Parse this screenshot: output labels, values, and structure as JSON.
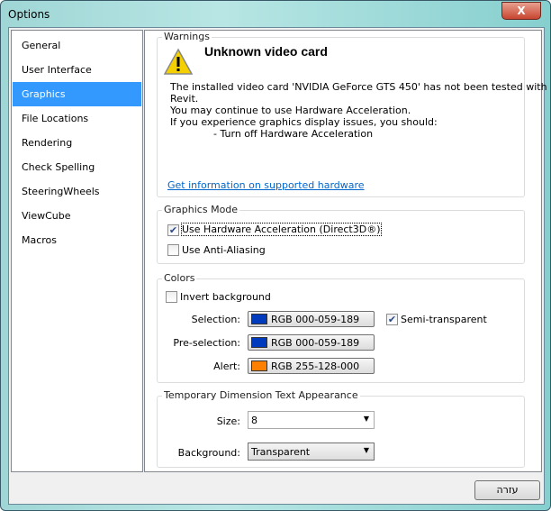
{
  "window": {
    "title": "Options",
    "close_label": "X"
  },
  "sidebar": {
    "items": [
      {
        "label": "General"
      },
      {
        "label": "User Interface"
      },
      {
        "label": "Graphics",
        "selected": true
      },
      {
        "label": "File Locations"
      },
      {
        "label": "Rendering"
      },
      {
        "label": "Check Spelling"
      },
      {
        "label": "SteeringWheels"
      },
      {
        "label": "ViewCube"
      },
      {
        "label": "Macros"
      }
    ]
  },
  "warnings": {
    "group_label": "Warnings",
    "heading": "Unknown video card",
    "line1": "The installed video card 'NVIDIA GeForce GTS 450' has not been tested with",
    "line2": "Revit.",
    "line3": "You may continue to use Hardware Acceleration.",
    "line4": "If you experience graphics display issues, you should:",
    "line5": "- Turn off Hardware Acceleration",
    "link": "Get information on supported hardware"
  },
  "graphics_mode": {
    "group_label": "Graphics Mode",
    "hw_accel": {
      "label": "Use Hardware Acceleration (Direct3D®)",
      "checked": true
    },
    "anti_alias": {
      "label": "Use Anti-Aliasing",
      "checked": false
    }
  },
  "colors": {
    "group_label": "Colors",
    "invert": {
      "label": "Invert background",
      "checked": false
    },
    "selection": {
      "label": "Selection:",
      "value": "RGB 000-059-189",
      "swatch": "#003bbd"
    },
    "semi_transparent": {
      "label": "Semi-transparent",
      "checked": true
    },
    "preselection": {
      "label": "Pre-selection:",
      "value": "RGB 000-059-189",
      "swatch": "#003bbd"
    },
    "alert": {
      "label": "Alert:",
      "value": "RGB 255-128-000",
      "swatch": "#ff8000"
    }
  },
  "temp_dim": {
    "group_label": "Temporary Dimension Text Appearance",
    "size_label": "Size:",
    "size_value": "8",
    "bg_label": "Background:",
    "bg_value": "Transparent"
  },
  "footer": {
    "help_label": "עזרה"
  }
}
